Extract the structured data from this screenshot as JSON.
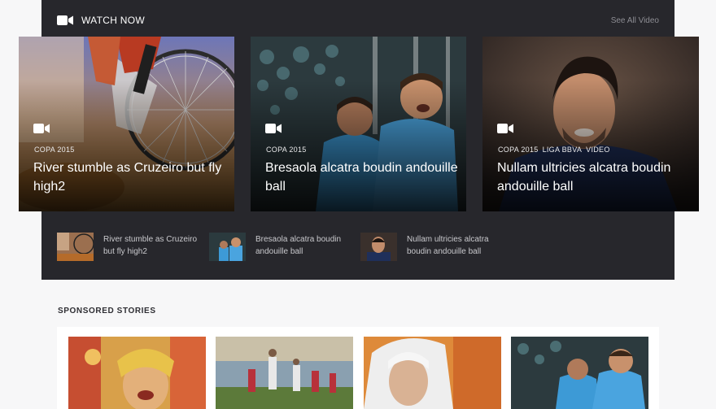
{
  "watch": {
    "title": "WATCH NOW",
    "see_all": "See All Video"
  },
  "featured": [
    {
      "tags": [
        "COPA 2015"
      ],
      "headline": "River stumble as Cruzeiro but fly high2"
    },
    {
      "tags": [
        "COPA 2015"
      ],
      "headline": "Bresaola alcatra boudin andouille ball"
    },
    {
      "tags": [
        "COPA 2015",
        "LIGA BBVA",
        "VIDEO"
      ],
      "headline": "Nullam ultricies alcatra boudin andouille ball"
    }
  ],
  "mini_list": [
    {
      "title": "River stumble as Cruzeiro but fly high2"
    },
    {
      "title": "Bresaola alcatra boudin andouille ball"
    },
    {
      "title": "Nullam ultricies alcatra boudin andouille ball"
    }
  ],
  "sponsored": {
    "heading": "SPONSORED STORIES"
  },
  "icons": {
    "video": "video-camera-icon"
  },
  "colors": {
    "panel_bg": "#27272c",
    "page_bg": "#f7f7f8",
    "accent_jersey": "#3d9ad6"
  }
}
